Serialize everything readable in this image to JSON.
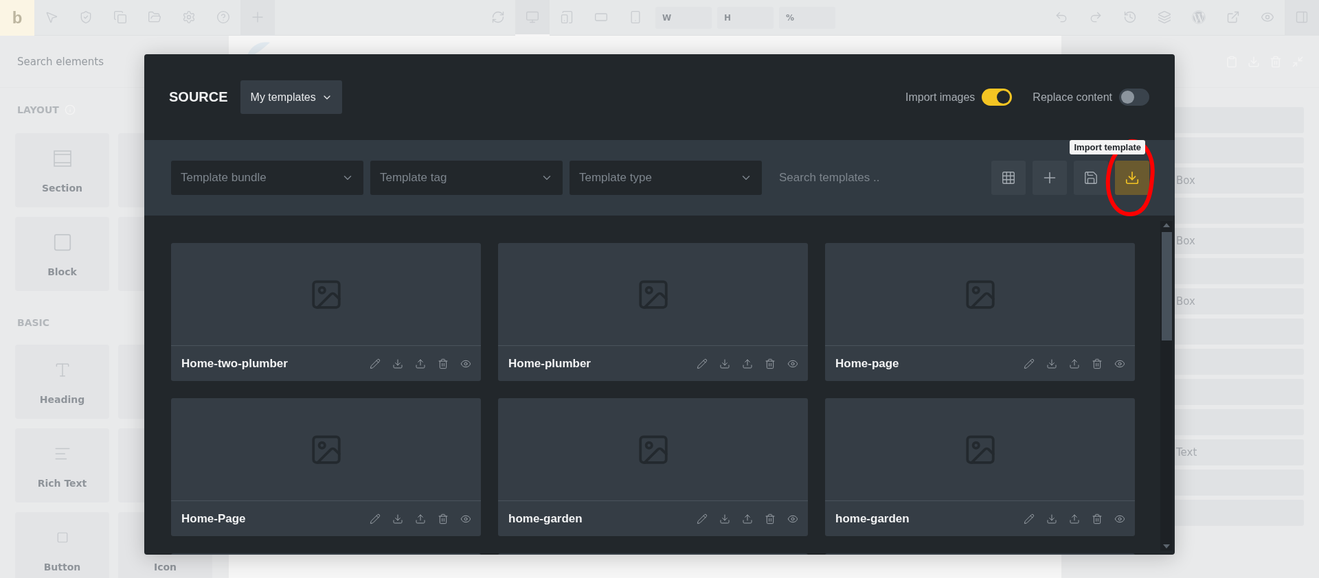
{
  "top_bar": {
    "logo": "b",
    "size_fields": [
      {
        "label": "W"
      },
      {
        "label": "H"
      },
      {
        "label": "%"
      }
    ]
  },
  "elements_panel": {
    "search": {
      "placeholder": "Search elements"
    },
    "groups": [
      {
        "title": "LAYOUT",
        "items": [
          {
            "kind": "section",
            "label": "Section"
          },
          {
            "kind": "columns"
          },
          {
            "kind": "block",
            "label": "Block"
          },
          {
            "kind": "blank"
          }
        ]
      },
      {
        "title": "BASIC",
        "items": [
          {
            "kind": "heading",
            "label": "Heading"
          },
          {
            "kind": "blank"
          },
          {
            "kind": "rich_text",
            "label": "Rich Text"
          },
          {
            "kind": "blank"
          },
          {
            "kind": "button",
            "label": "Button"
          },
          {
            "kind": "blank",
            "label": "Icon"
          }
        ]
      }
    ]
  },
  "layers_panel": {
    "rows": [
      {
        "kind": "blank"
      },
      {
        "kind": "blank"
      },
      {
        "kind": "labeled",
        "label": "Box"
      },
      {
        "kind": "blank"
      },
      {
        "kind": "labeled",
        "label": "Box"
      },
      {
        "kind": "blank"
      },
      {
        "kind": "labeled",
        "label": "Box"
      },
      {
        "kind": "blank"
      },
      {
        "kind": "blank"
      },
      {
        "kind": "blank"
      },
      {
        "kind": "blank"
      },
      {
        "kind": "labeled",
        "label": "Text"
      },
      {
        "kind": "blank"
      },
      {
        "kind": "blank"
      }
    ]
  },
  "template_modal": {
    "source_label": "SOURCE",
    "source_select": {
      "value": "My templates"
    },
    "toggles": [
      {
        "label": "Import images",
        "on": true
      },
      {
        "label": "Replace content",
        "on": false
      }
    ],
    "filters": [
      {
        "placeholder": "Template bundle"
      },
      {
        "placeholder": "Template tag"
      },
      {
        "placeholder": "Template type"
      }
    ],
    "search": {
      "placeholder": "Search templates .."
    },
    "tooltip": "Import template",
    "templates": [
      {
        "name": "Home-two-plumber"
      },
      {
        "name": "Home-plumber"
      },
      {
        "name": "Home-page"
      },
      {
        "name": "Home-Page"
      },
      {
        "name": "home-garden"
      },
      {
        "name": "home-garden"
      }
    ]
  }
}
